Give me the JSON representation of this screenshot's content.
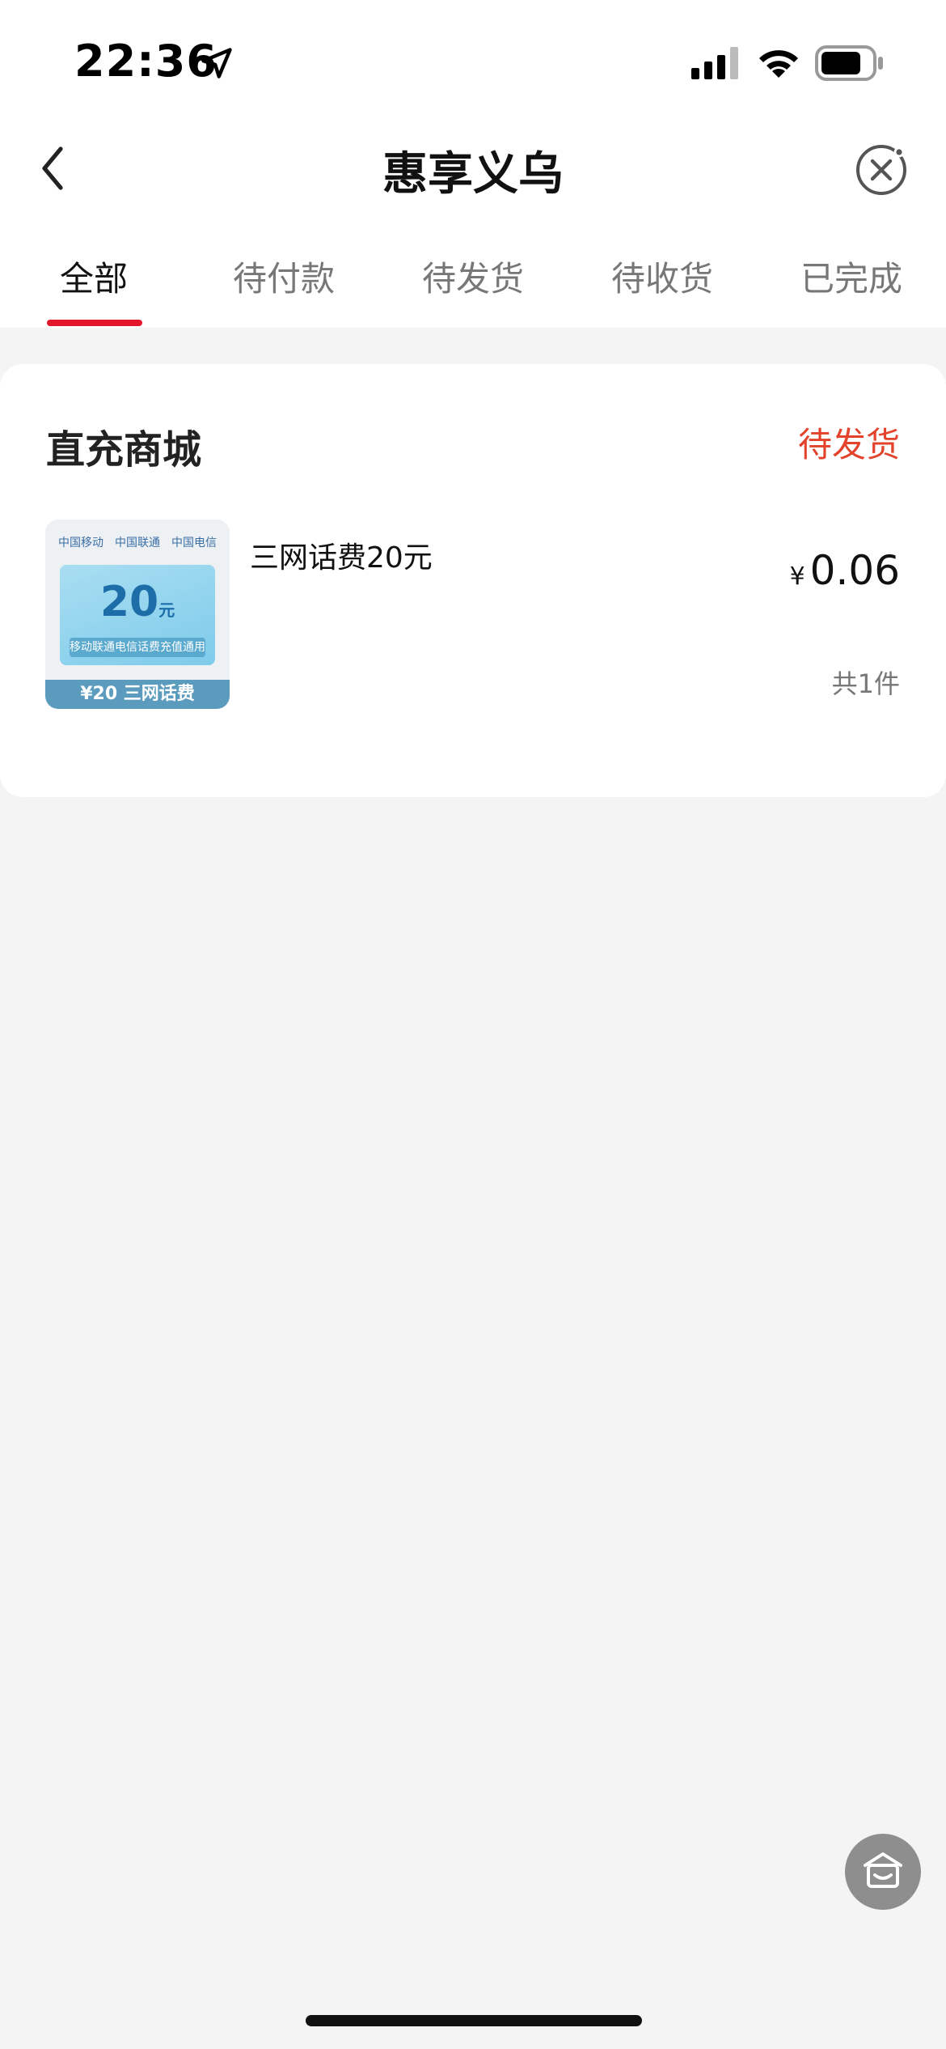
{
  "status_bar": {
    "time": "22:36",
    "icons": [
      "location-arrow-icon",
      "signal-icon",
      "wifi-icon",
      "battery-icon"
    ]
  },
  "nav": {
    "title": "惠享义乌",
    "back_icon": "chevron-left-icon",
    "close_icon": "close-circle-icon"
  },
  "tabs": [
    {
      "label": "全部",
      "active": true
    },
    {
      "label": "待付款",
      "active": false
    },
    {
      "label": "待发货",
      "active": false
    },
    {
      "label": "待收货",
      "active": false
    },
    {
      "label": "已完成",
      "active": false
    }
  ],
  "order": {
    "shop_name": "直充商城",
    "status": "待发货",
    "product_name": "三网话费20元",
    "price_symbol": "¥",
    "price": "0.06",
    "quantity": "共1件",
    "thumbnail": {
      "logos": [
        "中国移动",
        "中国联通",
        "中国电信"
      ],
      "amount": "20",
      "unit": "元",
      "desc": "移动联通电信话费充值通用",
      "footer": "¥20 三网话费"
    }
  },
  "float_button": {
    "icon": "home-service-icon"
  },
  "colors": {
    "accent": "#e3162c",
    "status": "#e2432a",
    "background": "#f4f4f4"
  }
}
